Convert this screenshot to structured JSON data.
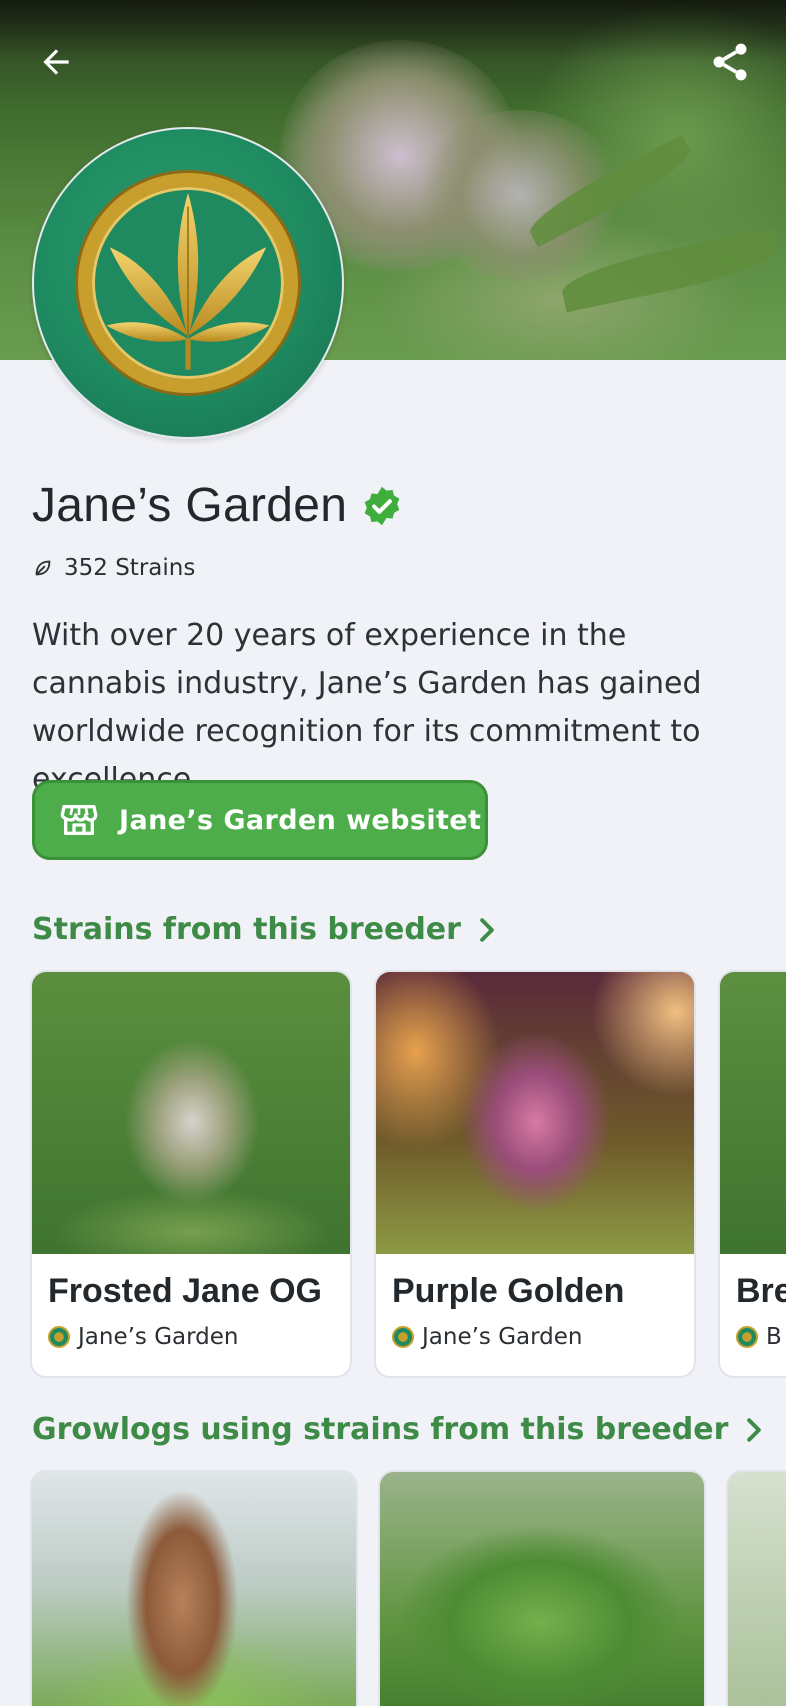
{
  "nav": {
    "back_icon": "arrow-left-icon",
    "share_icon": "share-icon"
  },
  "breeder": {
    "name": "Jane’s Garden",
    "strain_count": "352 Strains",
    "bio": "With over 20 years of experience in the cannabis industry, Jane’s Garden has gained worldwide recognition for its commitment to excellence.",
    "website_label": "Jane’s Garden websitet"
  },
  "strains_section": {
    "title": "Strains from this breeder",
    "cards": [
      {
        "name": "Frosted Jane OG",
        "breeder": "Jane’s Garden"
      },
      {
        "name": "Purple Golden",
        "breeder": "Jane’s Garden"
      },
      {
        "name": "Bre",
        "breeder": "B"
      }
    ]
  },
  "growlogs_section": {
    "title": "Growlogs using strains from this breeder"
  },
  "colors": {
    "accent": "#4cad4a",
    "section_title": "#3e8a47",
    "background": "#f1f2f7",
    "verified": "#3fae3c"
  }
}
